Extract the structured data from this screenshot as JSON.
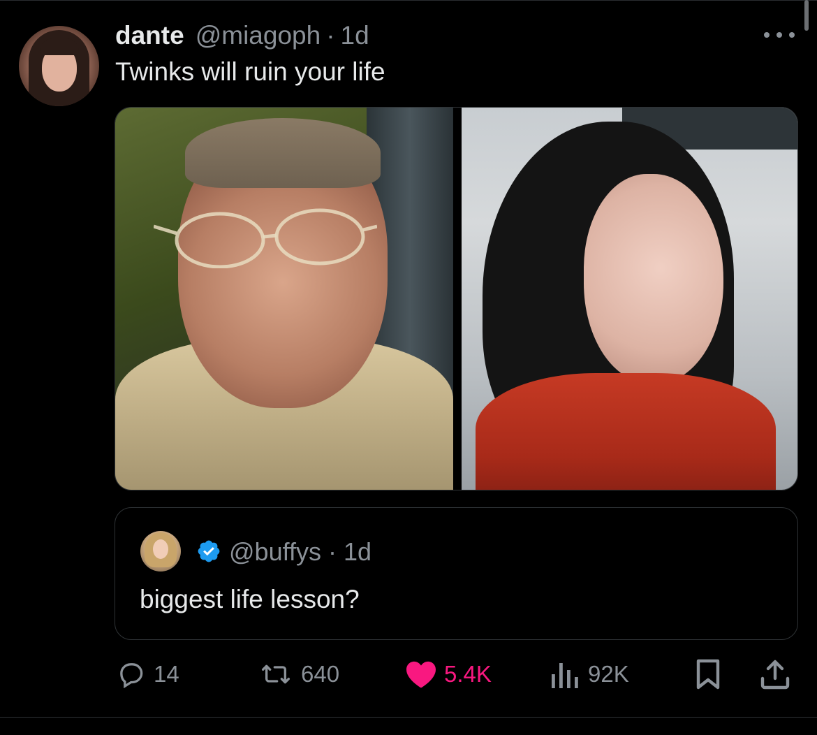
{
  "tweet": {
    "display_name": "dante",
    "handle": "@miagoph",
    "separator": "·",
    "time": "1d",
    "text": "Twinks will ruin your life",
    "avatar_icon": "avatar-photo",
    "more_icon": "more-horizontal-icon"
  },
  "media": {
    "images": [
      "photo-left",
      "photo-right"
    ]
  },
  "quote": {
    "handle": "@buffys",
    "separator": "·",
    "time": "1d",
    "text": "biggest life lesson?",
    "verified": true,
    "verified_color": "#1d9bf0"
  },
  "actions": {
    "reply_count": "14",
    "retweet_count": "640",
    "like_count": "5.4K",
    "views_count": "92K",
    "like_color": "#f91880",
    "muted_color": "#8b9198"
  }
}
